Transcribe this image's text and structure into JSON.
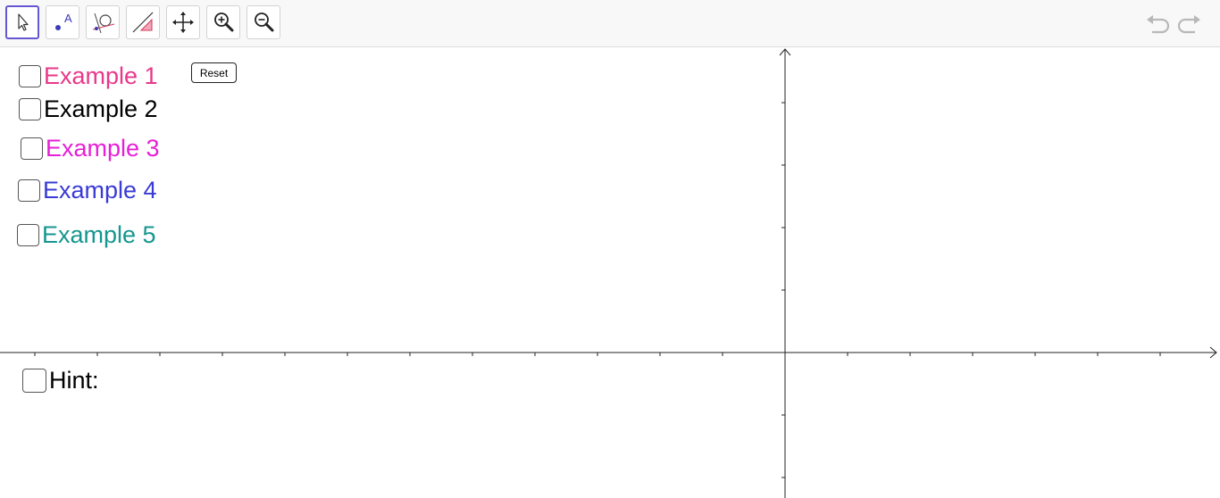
{
  "toolbar": {
    "tools": [
      {
        "name": "move-tool",
        "icon": "cursor-arrow-icon",
        "active": true
      },
      {
        "name": "point-tool",
        "icon": "point-label-icon",
        "label_glyph": "A"
      },
      {
        "name": "tangent-tool",
        "icon": "tangent-circle-icon"
      },
      {
        "name": "slope-tool",
        "icon": "slope-triangle-icon"
      },
      {
        "name": "move-view-tool",
        "icon": "move-arrows-icon"
      },
      {
        "name": "zoom-in-tool",
        "icon": "zoom-in-icon"
      },
      {
        "name": "zoom-out-tool",
        "icon": "zoom-out-icon"
      }
    ],
    "undo_icon": "undo-icon",
    "redo_icon": "redo-icon",
    "accent": "#6557d2"
  },
  "examples": [
    {
      "label": "Example 1",
      "color": "#e8388a",
      "checked": false
    },
    {
      "label": "Example 2",
      "color": "#000000",
      "checked": false
    },
    {
      "label": "Example 3",
      "color": "#e61fd6",
      "checked": false
    },
    {
      "label": "Example 4",
      "color": "#3a3ad6",
      "checked": false
    },
    {
      "label": "Example 5",
      "color": "#15968f",
      "checked": false
    }
  ],
  "reset": {
    "label": "Reset"
  },
  "hint": {
    "label": "Hint:",
    "color": "#000000",
    "checked": false
  }
}
